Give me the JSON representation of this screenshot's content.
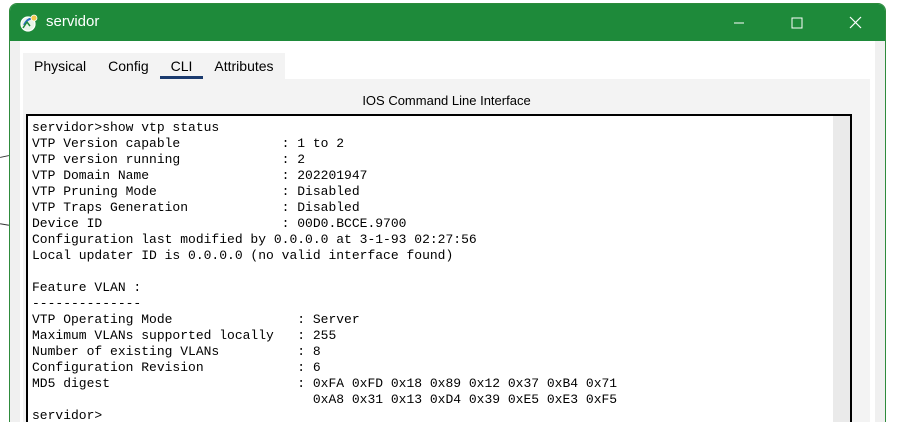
{
  "window": {
    "title": "servidor",
    "minimize_icon": "minimize-icon",
    "maximize_icon": "maximize-icon",
    "close_icon": "close-icon"
  },
  "tabs": [
    {
      "label": "Physical",
      "active": false
    },
    {
      "label": "Config",
      "active": false
    },
    {
      "label": "CLI",
      "active": true
    },
    {
      "label": "Attributes",
      "active": false
    }
  ],
  "cli": {
    "heading": "IOS Command Line Interface",
    "output": "servidor>show vtp status\nVTP Version capable             : 1 to 2\nVTP version running             : 2\nVTP Domain Name                 : 202201947\nVTP Pruning Mode                : Disabled\nVTP Traps Generation            : Disabled\nDevice ID                       : 00D0.BCCE.9700\nConfiguration last modified by 0.0.0.0 at 3-1-93 02:27:56\nLocal updater ID is 0.0.0.0 (no valid interface found)\n\nFeature VLAN :\n--------------\nVTP Operating Mode                : Server\nMaximum VLANs supported locally   : 255\nNumber of existing VLANs          : 8\nConfiguration Revision            : 6\nMD5 digest                        : 0xFA 0xFD 0x18 0x89 0x12 0x37 0xB4 0x71\n                                    0xA8 0x31 0x13 0xD4 0x39 0xE5 0xE3 0xF5\nservidor>"
  },
  "colors": {
    "titlebar": "#1e8a3a",
    "tab_underline": "#1a3a6e"
  }
}
